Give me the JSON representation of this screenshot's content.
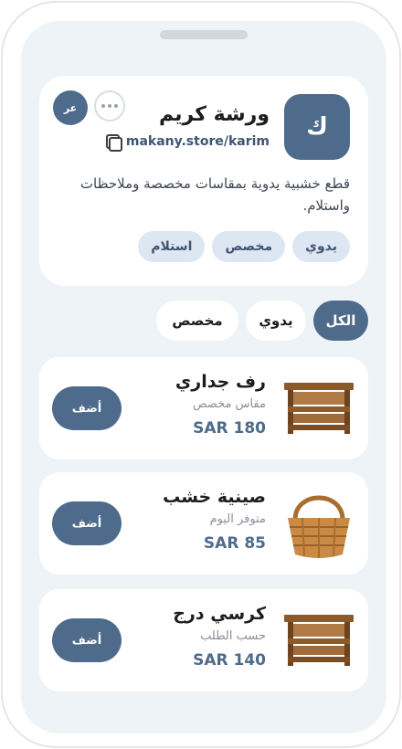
{
  "profile": {
    "avatar_letter": "ك",
    "shop_name": "ورشة كريم",
    "shop_url": "makany.store/karim",
    "lang_label": "عر",
    "description": "قطع خشبية يدوية بمقاسات مخصصة وملاحظات واستلام.",
    "tags": [
      "يدوي",
      "مخصص",
      "استلام"
    ]
  },
  "filters": [
    "الكل",
    "يدوي",
    "مخصص"
  ],
  "active_filter": "الكل",
  "currency": "SAR",
  "products": [
    {
      "name": "رف جداري",
      "subtitle": "مقاس مخصص",
      "price": "SAR 180",
      "add_label": "أضف",
      "image": "wooden-shelf"
    },
    {
      "name": "صينية خشب",
      "subtitle": "متوفر اليوم",
      "price": "SAR 85",
      "add_label": "أضف",
      "image": "wicker-basket"
    },
    {
      "name": "كرسي درج",
      "subtitle": "حسب الطلب",
      "price": "SAR 140",
      "add_label": "أضف",
      "image": "wooden-shelf"
    }
  ],
  "colors": {
    "accent": "#4e6b8c",
    "background": "#eef3f8",
    "tag_bg": "#dde7f1"
  }
}
